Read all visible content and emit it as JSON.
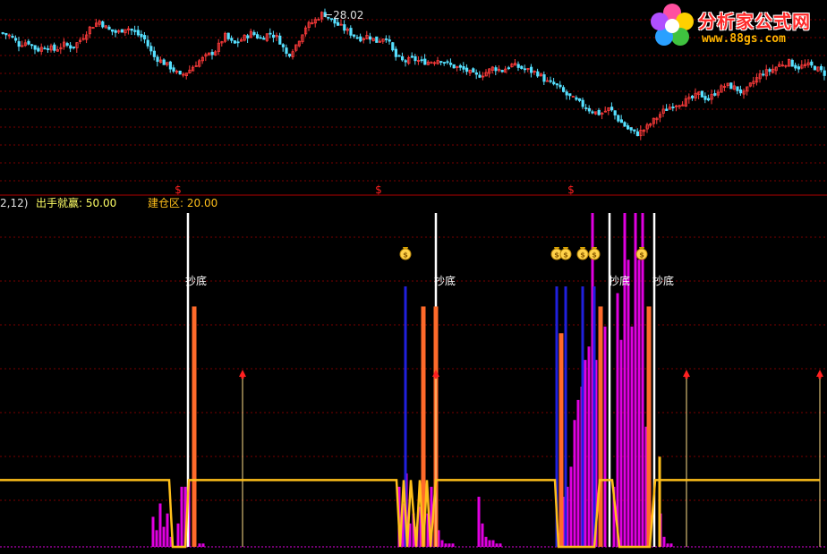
{
  "colors": {
    "bg": "#000000",
    "grid": "#7a0000",
    "up": "#ff3b3b",
    "down": "#56e0ff",
    "white": "#ffffff",
    "magenta": "#e000e0",
    "orange": "#ff6a2a",
    "blue": "#2020dd",
    "yellow": "#ffbf1a",
    "legend_gold": "#ffff66",
    "red_arrow": "#ff2020",
    "divider": "#b00000"
  },
  "logo": {
    "name": "分析家公式网",
    "url": "www.88gs.com"
  },
  "price_panel": {
    "max_label": "28.02",
    "signal_marker": "$",
    "signal_x": [
      199,
      423,
      638
    ]
  },
  "indicator_panel": {
    "header_left": "2,12)",
    "legend": [
      {
        "label": "出手就赢",
        "value": "50.00",
        "color": "#ffff66"
      },
      {
        "label": "建仓区",
        "value": "20.00",
        "color": "#ffbf1a"
      }
    ],
    "bottom_label": "抄底",
    "bag_icon": "money-bag-icon",
    "arrow_icon": "up-arrow-icon"
  },
  "chart_data": [
    {
      "type": "candlestick",
      "title": "",
      "annotation_max": "28.02",
      "close_path": [
        [
          0,
          0.86
        ],
        [
          10,
          0.84
        ],
        [
          20,
          0.78
        ],
        [
          30,
          0.8
        ],
        [
          40,
          0.74
        ],
        [
          50,
          0.77
        ],
        [
          60,
          0.74
        ],
        [
          70,
          0.78
        ],
        [
          80,
          0.76
        ],
        [
          90,
          0.82
        ],
        [
          100,
          0.9
        ],
        [
          110,
          0.94
        ],
        [
          120,
          0.88
        ],
        [
          130,
          0.86
        ],
        [
          140,
          0.9
        ],
        [
          150,
          0.86
        ],
        [
          160,
          0.82
        ],
        [
          170,
          0.7
        ],
        [
          180,
          0.66
        ],
        [
          190,
          0.62
        ],
        [
          200,
          0.56
        ],
        [
          210,
          0.6
        ],
        [
          220,
          0.66
        ],
        [
          230,
          0.7
        ],
        [
          240,
          0.74
        ],
        [
          250,
          0.84
        ],
        [
          260,
          0.78
        ],
        [
          270,
          0.82
        ],
        [
          280,
          0.86
        ],
        [
          290,
          0.82
        ],
        [
          300,
          0.86
        ],
        [
          310,
          0.82
        ],
        [
          320,
          0.7
        ],
        [
          330,
          0.78
        ],
        [
          340,
          0.9
        ],
        [
          350,
          0.94
        ],
        [
          360,
          1.0
        ],
        [
          370,
          0.94
        ],
        [
          380,
          0.9
        ],
        [
          390,
          0.86
        ],
        [
          400,
          0.82
        ],
        [
          410,
          0.84
        ],
        [
          420,
          0.8
        ],
        [
          430,
          0.84
        ],
        [
          440,
          0.7
        ],
        [
          450,
          0.66
        ],
        [
          460,
          0.68
        ],
        [
          470,
          0.66
        ],
        [
          480,
          0.66
        ],
        [
          490,
          0.68
        ],
        [
          500,
          0.64
        ],
        [
          510,
          0.62
        ],
        [
          520,
          0.6
        ],
        [
          530,
          0.56
        ],
        [
          540,
          0.58
        ],
        [
          550,
          0.62
        ],
        [
          560,
          0.6
        ],
        [
          570,
          0.64
        ],
        [
          580,
          0.62
        ],
        [
          590,
          0.6
        ],
        [
          600,
          0.58
        ],
        [
          610,
          0.52
        ],
        [
          620,
          0.5
        ],
        [
          630,
          0.44
        ],
        [
          640,
          0.4
        ],
        [
          650,
          0.36
        ],
        [
          660,
          0.32
        ],
        [
          670,
          0.3
        ],
        [
          680,
          0.34
        ],
        [
          690,
          0.26
        ],
        [
          700,
          0.2
        ],
        [
          710,
          0.16
        ],
        [
          720,
          0.2
        ],
        [
          730,
          0.26
        ],
        [
          740,
          0.32
        ],
        [
          750,
          0.36
        ],
        [
          760,
          0.38
        ],
        [
          770,
          0.4
        ],
        [
          780,
          0.44
        ],
        [
          790,
          0.4
        ],
        [
          800,
          0.46
        ],
        [
          810,
          0.5
        ],
        [
          820,
          0.48
        ],
        [
          830,
          0.44
        ],
        [
          840,
          0.52
        ],
        [
          850,
          0.58
        ],
        [
          860,
          0.6
        ],
        [
          870,
          0.64
        ],
        [
          880,
          0.66
        ],
        [
          890,
          0.62
        ],
        [
          900,
          0.64
        ],
        [
          910,
          0.62
        ],
        [
          920,
          0.58
        ]
      ]
    },
    {
      "type": "bar",
      "title": "",
      "ylim": [
        0,
        100
      ],
      "reference_lines": [
        {
          "label": "出手就赢",
          "value": 50
        },
        {
          "label": "建仓区",
          "value": 20
        }
      ],
      "series": [
        {
          "kind": "white_line",
          "x": [
            210,
            487,
            681,
            731
          ]
        },
        {
          "kind": "orange_bar",
          "bars": [
            [
              217,
              72
            ],
            [
              473,
              72
            ],
            [
              487,
              72
            ],
            [
              627,
              64
            ],
            [
              671,
              72
            ],
            [
              725,
              72
            ]
          ]
        },
        {
          "kind": "blue_line",
          "bars": [
            [
              453,
              78
            ],
            [
              622,
              78
            ],
            [
              632,
              78
            ],
            [
              651,
              78
            ],
            [
              664,
              78
            ]
          ]
        },
        {
          "kind": "magenta_bar",
          "bars": [
            [
              171,
              9
            ],
            [
              175,
              5
            ],
            [
              179,
              13
            ],
            [
              183,
              6
            ],
            [
              187,
              10
            ],
            [
              191,
              3
            ],
            [
              199,
              7
            ],
            [
              203,
              18
            ],
            [
              207,
              18
            ],
            [
              211,
              20
            ],
            [
              223,
              1
            ],
            [
              227,
              1
            ],
            [
              446,
              18
            ],
            [
              450,
              13
            ],
            [
              454,
              22
            ],
            [
              458,
              7
            ],
            [
              462,
              10
            ],
            [
              466,
              6
            ],
            [
              470,
              12
            ],
            [
              474,
              3
            ],
            [
              478,
              10
            ],
            [
              482,
              18
            ],
            [
              490,
              5
            ],
            [
              494,
              2
            ],
            [
              498,
              1
            ],
            [
              502,
              1
            ],
            [
              506,
              1
            ],
            [
              535,
              15
            ],
            [
              539,
              7
            ],
            [
              543,
              3
            ],
            [
              547,
              2
            ],
            [
              551,
              2
            ],
            [
              555,
              1
            ],
            [
              559,
              1
            ],
            [
              626,
              8
            ],
            [
              630,
              15
            ],
            [
              634,
              18
            ],
            [
              638,
              24
            ],
            [
              642,
              38
            ],
            [
              646,
              44
            ],
            [
              650,
              48
            ],
            [
              654,
              56
            ],
            [
              658,
              60
            ],
            [
              662,
              100
            ],
            [
              666,
              56
            ],
            [
              676,
              66
            ],
            [
              686,
              18
            ],
            [
              690,
              76
            ],
            [
              694,
              62
            ],
            [
              698,
              100
            ],
            [
              702,
              86
            ],
            [
              706,
              66
            ],
            [
              710,
              100
            ],
            [
              714,
              86
            ],
            [
              718,
              100
            ],
            [
              722,
              36
            ],
            [
              726,
              42
            ],
            [
              738,
              10
            ],
            [
              742,
              3
            ],
            [
              746,
              1
            ],
            [
              750,
              1
            ]
          ]
        },
        {
          "kind": "yellow_bar",
          "bars": [
            [
              737,
              27
            ]
          ]
        },
        {
          "kind": "arrow_line",
          "x": [
            271,
            487,
            767,
            916
          ],
          "value": 52
        },
        {
          "kind": "yellow_line",
          "values_path": [
            [
              0,
              20
            ],
            [
              189,
              20
            ],
            [
              193,
              0
            ],
            [
              207,
              0
            ],
            [
              211,
              20
            ],
            [
              215,
              20
            ],
            [
              219,
              20
            ],
            [
              443,
              20
            ],
            [
              447,
              0
            ],
            [
              451,
              20
            ],
            [
              455,
              0
            ],
            [
              459,
              20
            ],
            [
              465,
              0
            ],
            [
              469,
              20
            ],
            [
              473,
              0
            ],
            [
              477,
              20
            ],
            [
              481,
              0
            ],
            [
              487,
              20
            ],
            [
              489,
              20
            ],
            [
              620,
              20
            ],
            [
              624,
              0
            ],
            [
              664,
              0
            ],
            [
              670,
              20
            ],
            [
              684,
              20
            ],
            [
              692,
              0
            ],
            [
              726,
              0
            ],
            [
              732,
              20
            ],
            [
              916,
              20
            ]
          ]
        },
        {
          "kind": "money_bag",
          "x": [
            453,
            622,
            632,
            651,
            664,
            717
          ]
        },
        {
          "kind": "label_抄底",
          "x": [
            219,
            497,
            692,
            741
          ]
        }
      ]
    }
  ]
}
